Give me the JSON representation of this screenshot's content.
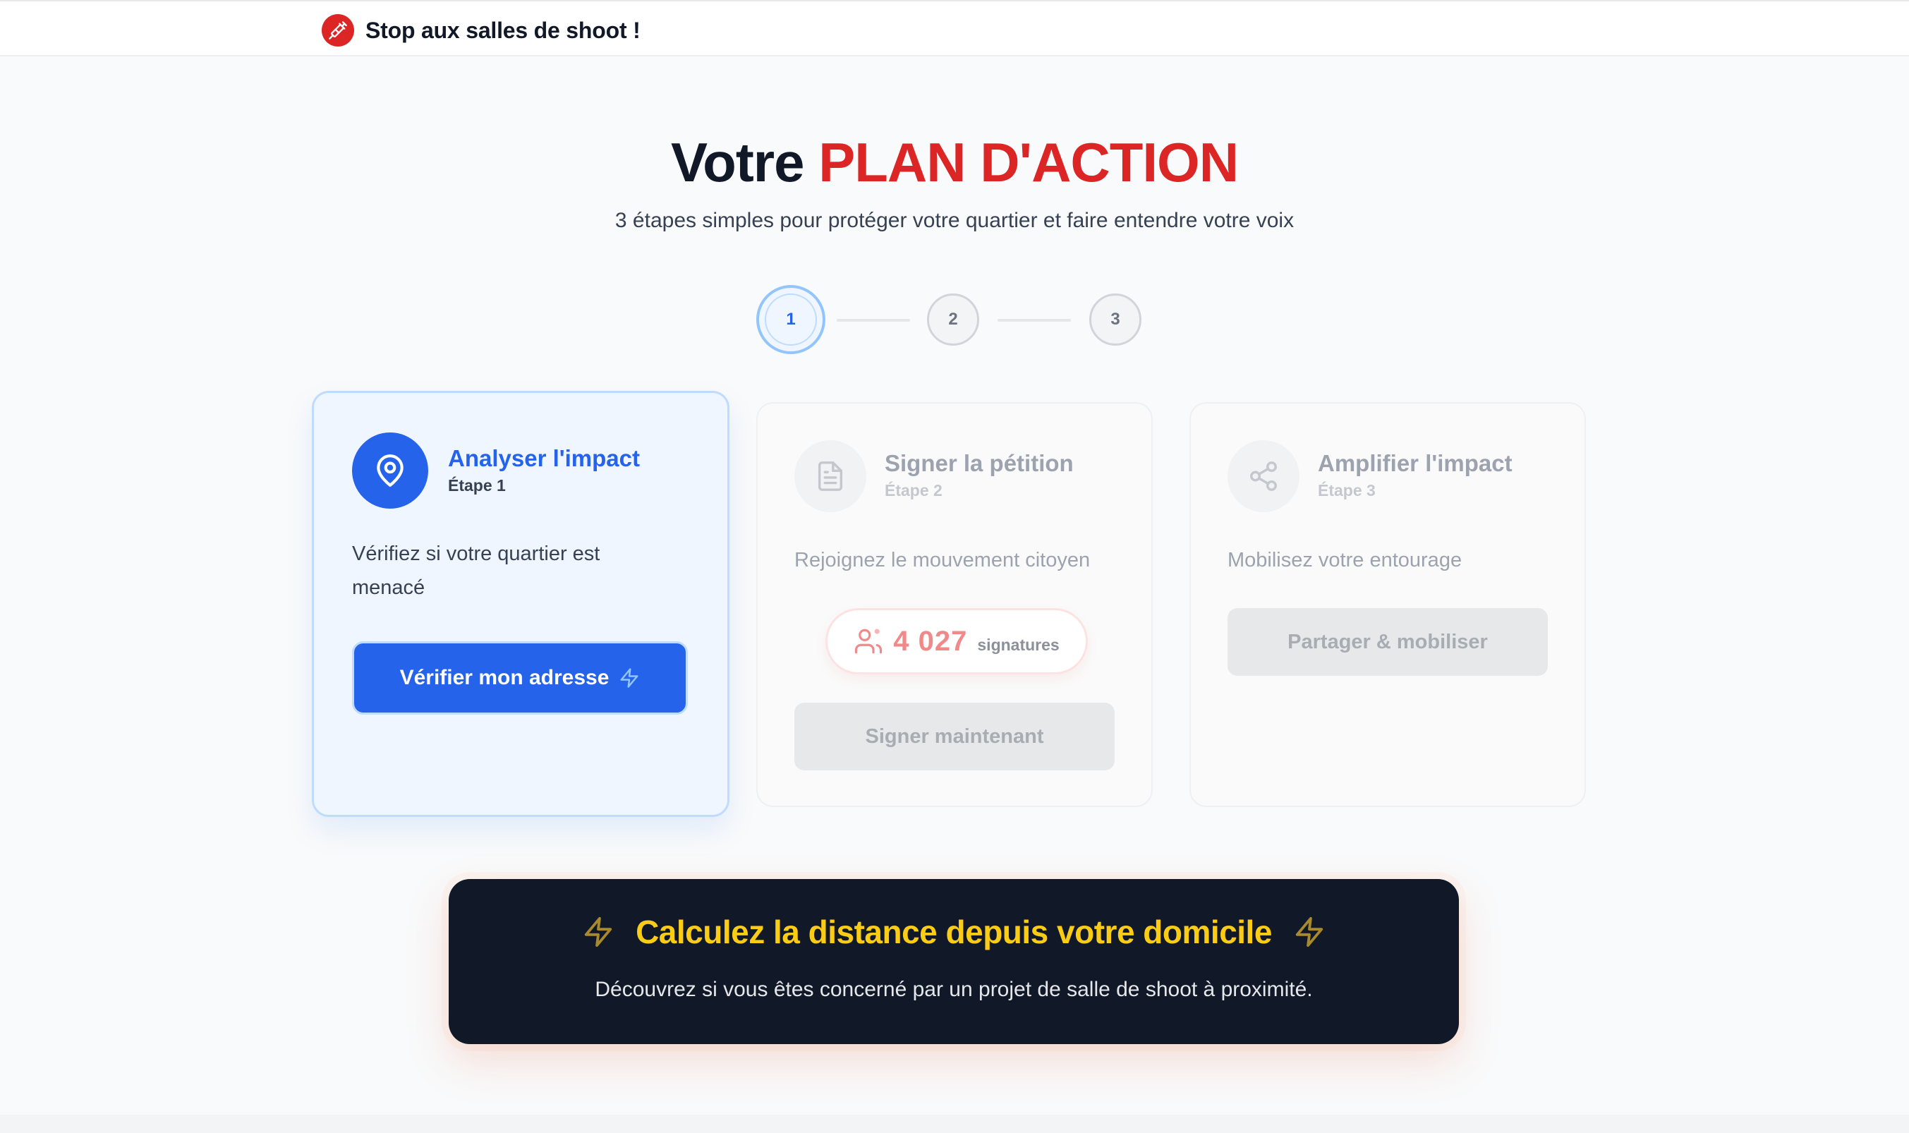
{
  "header": {
    "brand_name": "Stop aux salles de shoot !",
    "brand_icon": "syringe-icon",
    "brand_color": "#dc2626"
  },
  "hero": {
    "title_part1": "Votre",
    "title_part2": "PLAN D'ACTION",
    "subtitle": "3 étapes simples pour protéger votre quartier et faire entendre votre voix"
  },
  "stepper": {
    "steps": [
      "1",
      "2",
      "3"
    ],
    "active_index": 0
  },
  "cards": [
    {
      "title": "Analyser l'impact",
      "step_label": "Étape 1",
      "description": "Vérifiez si votre quartier est menacé",
      "icon": "map-pin-icon",
      "button_label": "Vérifier mon adresse",
      "button_icon": "lightning-icon",
      "state": "active"
    },
    {
      "title": "Signer la pétition",
      "step_label": "Étape 2",
      "description": "Rejoignez le mouvement citoyen",
      "icon": "document-icon",
      "signature_count": "4 027",
      "signature_label": "signatures",
      "button_label": "Signer maintenant",
      "state": "disabled"
    },
    {
      "title": "Amplifier l'impact",
      "step_label": "Étape 3",
      "description": "Mobilisez votre entourage",
      "icon": "share-icon",
      "button_label": "Partager & mobiliser",
      "state": "disabled"
    }
  ],
  "banner": {
    "title": "Calculez la distance depuis votre domicile",
    "subtitle": "Découvrez si vous êtes concerné par un projet de salle de shoot à proximité.",
    "icon": "lightning-icon",
    "title_color": "#facc15",
    "background": "#111827"
  },
  "colors": {
    "accent_blue": "#2563eb",
    "accent_red": "#dc2626"
  }
}
